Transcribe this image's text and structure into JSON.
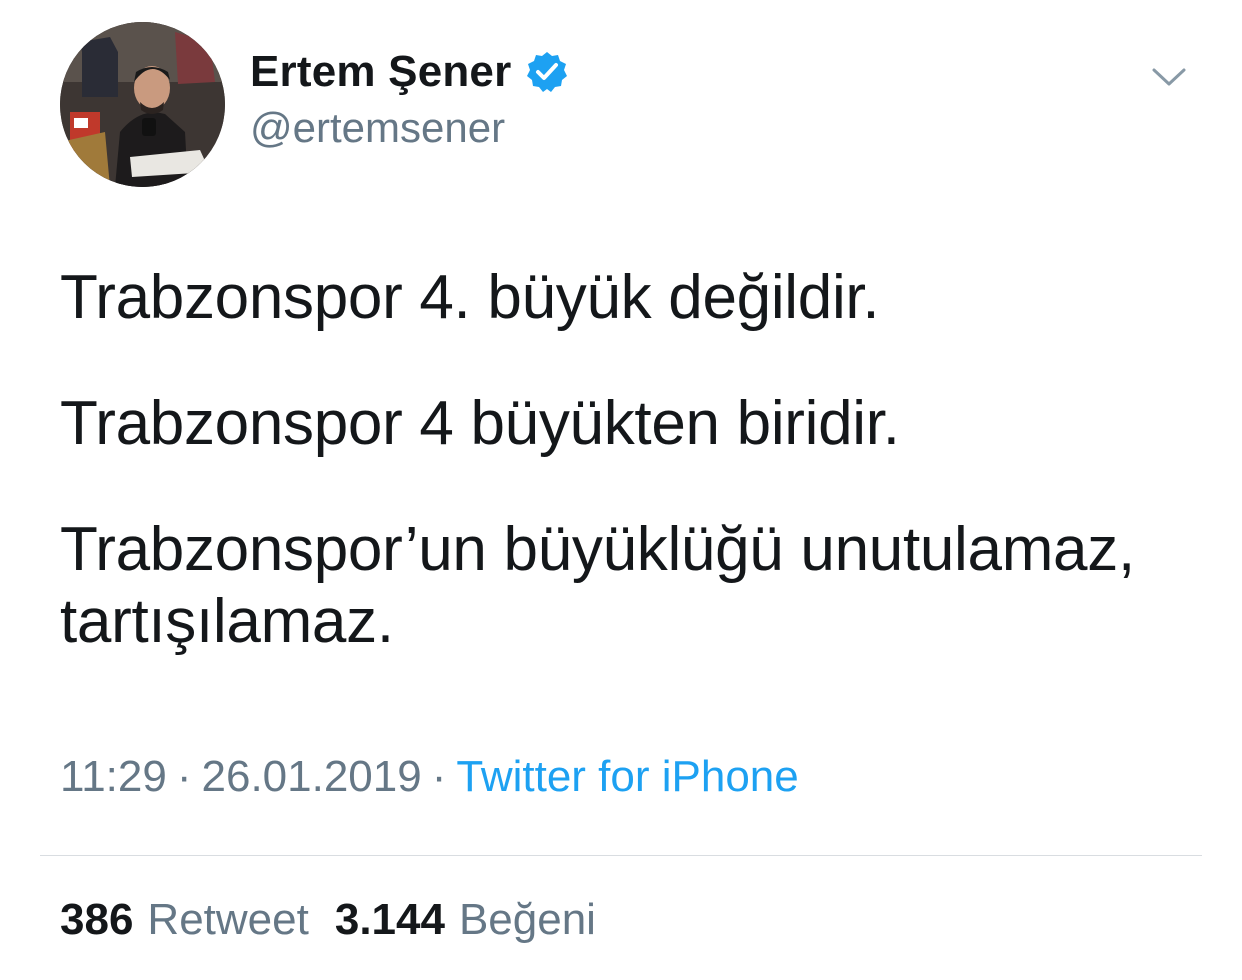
{
  "tweet": {
    "author": {
      "display_name": "Ertem Şener",
      "handle": "@ertemsener",
      "verified": true,
      "avatar_icon": "profile-photo"
    },
    "text_paragraphs": [
      "Trabzonspor 4. büyük değildir.",
      "Trabzonspor 4 büyükten biridir.",
      "Trabzonspor’un büyüklüğü unutulamaz, tartışılamaz."
    ],
    "time": "11:29",
    "date": "26.01.2019",
    "source": "Twitter for iPhone",
    "separator": "·",
    "stats": {
      "retweets_count": "386",
      "retweets_label": "Retweet",
      "likes_count": "3.144",
      "likes_label": "Beğeni"
    }
  },
  "colors": {
    "text_primary": "#14171a",
    "text_secondary": "#657786",
    "link": "#1da1f2",
    "verified_badge": "#1da1f2",
    "divider": "#d9dde1"
  },
  "icons": {
    "verified": "verified-badge-icon",
    "more": "chevron-down-icon"
  }
}
